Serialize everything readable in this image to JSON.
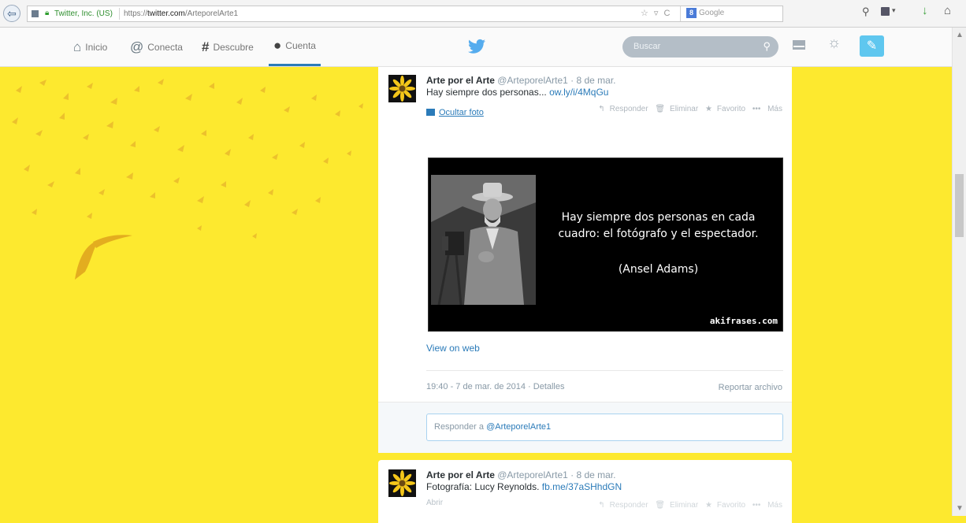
{
  "browser": {
    "back_icon": "back-arrow-icon",
    "site_identity": "Twitter, Inc. (US)",
    "url_prefix": "https://",
    "url_domain": "twitter.com",
    "url_path": "/ArteporelArte1",
    "url_icons": "☆ ▿ C",
    "search_engine": "Google",
    "search_engine_letter": "8"
  },
  "nav": {
    "items": [
      {
        "label": "Inicio",
        "icon": "home-icon"
      },
      {
        "label": "Conecta",
        "icon": "at-icon"
      },
      {
        "label": "Descubre",
        "icon": "hash-icon"
      },
      {
        "label": "Cuenta",
        "icon": "person-icon",
        "active": true
      }
    ],
    "search_placeholder": "Buscar",
    "accent_color": "#2b7bb9"
  },
  "tweets": [
    {
      "name": "Arte por el Arte",
      "handle": "@ArteporelArte1",
      "date": "· 8 de mar.",
      "text": "Hay siempre dos personas...",
      "link": "ow.ly/i/4MqGu",
      "hide_photo": "Ocultar foto",
      "actions": [
        "Responder",
        "Eliminar",
        "Favorito",
        "Más"
      ],
      "image": {
        "quote": "Hay siempre dos personas en cada cuadro: el fotógrafo y el espectador.",
        "author": "(Ansel Adams)",
        "watermark": "akifrases.com"
      },
      "view_web": "View on web",
      "timestamp": "19:40 - 7 de mar. de 2014 · Detalles",
      "report": "Reportar archivo",
      "reply_prefix": "Responder a",
      "reply_handle": "@ArteporelArte1"
    },
    {
      "name": "Arte por el Arte",
      "handle": "@ArteporelArte1",
      "date": "· 8 de mar.",
      "text": "Fotografía: Lucy Reynolds.",
      "link": "fb.me/37aSHhdGN",
      "open": "Abrir",
      "actions": [
        "Responder",
        "Eliminar",
        "Favorito",
        "Más"
      ]
    }
  ],
  "colors": {
    "background": "#fde92f",
    "link": "#2b7bb9",
    "compose": "#5fc7ef"
  }
}
